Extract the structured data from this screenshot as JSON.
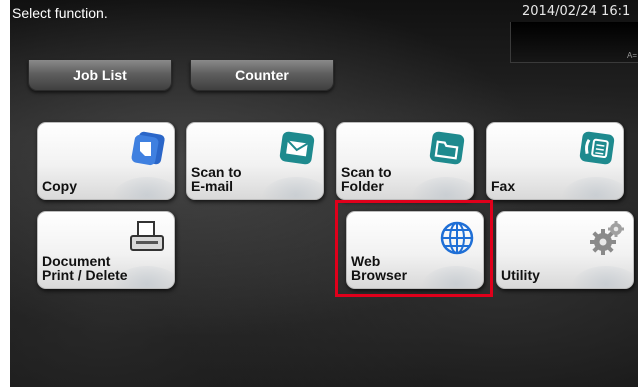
{
  "header": {
    "title": "Select function.",
    "datetime": "2014/02/24 16:1"
  },
  "status_glyph": "A=",
  "tabs": [
    {
      "label": "Job List"
    },
    {
      "label": "Counter"
    }
  ],
  "functions": [
    {
      "label": "Copy",
      "icon": "copy-icon"
    },
    {
      "label": "Scan to\nE-mail",
      "icon": "envelope-icon"
    },
    {
      "label": "Scan to\nFolder",
      "icon": "folder-icon"
    },
    {
      "label": "Fax",
      "icon": "fax-icon"
    },
    {
      "label": "Document\nPrint / Delete",
      "icon": "document-print-icon"
    },
    {
      "label": "Web\nBrowser",
      "icon": "globe-icon"
    },
    {
      "label": "Utility",
      "icon": "gear-icon"
    }
  ],
  "highlighted_function": "Web Browser",
  "colors": {
    "highlight": "#e0001b",
    "icon_teal": "#1e8a8e",
    "icon_blue": "#2a66c8"
  }
}
